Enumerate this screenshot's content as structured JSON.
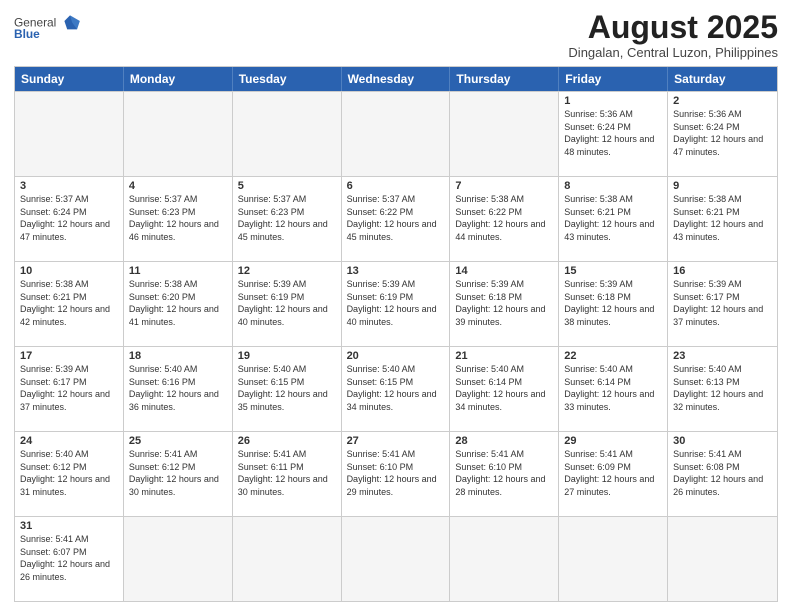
{
  "header": {
    "logo_general": "General",
    "logo_blue": "Blue",
    "month_year": "August 2025",
    "location": "Dingalan, Central Luzon, Philippines"
  },
  "weekdays": [
    "Sunday",
    "Monday",
    "Tuesday",
    "Wednesday",
    "Thursday",
    "Friday",
    "Saturday"
  ],
  "weeks": [
    [
      {
        "day": "",
        "info": ""
      },
      {
        "day": "",
        "info": ""
      },
      {
        "day": "",
        "info": ""
      },
      {
        "day": "",
        "info": ""
      },
      {
        "day": "",
        "info": ""
      },
      {
        "day": "1",
        "info": "Sunrise: 5:36 AM\nSunset: 6:24 PM\nDaylight: 12 hours and 48 minutes."
      },
      {
        "day": "2",
        "info": "Sunrise: 5:36 AM\nSunset: 6:24 PM\nDaylight: 12 hours and 47 minutes."
      }
    ],
    [
      {
        "day": "3",
        "info": "Sunrise: 5:37 AM\nSunset: 6:24 PM\nDaylight: 12 hours and 47 minutes."
      },
      {
        "day": "4",
        "info": "Sunrise: 5:37 AM\nSunset: 6:23 PM\nDaylight: 12 hours and 46 minutes."
      },
      {
        "day": "5",
        "info": "Sunrise: 5:37 AM\nSunset: 6:23 PM\nDaylight: 12 hours and 45 minutes."
      },
      {
        "day": "6",
        "info": "Sunrise: 5:37 AM\nSunset: 6:22 PM\nDaylight: 12 hours and 45 minutes."
      },
      {
        "day": "7",
        "info": "Sunrise: 5:38 AM\nSunset: 6:22 PM\nDaylight: 12 hours and 44 minutes."
      },
      {
        "day": "8",
        "info": "Sunrise: 5:38 AM\nSunset: 6:21 PM\nDaylight: 12 hours and 43 minutes."
      },
      {
        "day": "9",
        "info": "Sunrise: 5:38 AM\nSunset: 6:21 PM\nDaylight: 12 hours and 43 minutes."
      }
    ],
    [
      {
        "day": "10",
        "info": "Sunrise: 5:38 AM\nSunset: 6:21 PM\nDaylight: 12 hours and 42 minutes."
      },
      {
        "day": "11",
        "info": "Sunrise: 5:38 AM\nSunset: 6:20 PM\nDaylight: 12 hours and 41 minutes."
      },
      {
        "day": "12",
        "info": "Sunrise: 5:39 AM\nSunset: 6:19 PM\nDaylight: 12 hours and 40 minutes."
      },
      {
        "day": "13",
        "info": "Sunrise: 5:39 AM\nSunset: 6:19 PM\nDaylight: 12 hours and 40 minutes."
      },
      {
        "day": "14",
        "info": "Sunrise: 5:39 AM\nSunset: 6:18 PM\nDaylight: 12 hours and 39 minutes."
      },
      {
        "day": "15",
        "info": "Sunrise: 5:39 AM\nSunset: 6:18 PM\nDaylight: 12 hours and 38 minutes."
      },
      {
        "day": "16",
        "info": "Sunrise: 5:39 AM\nSunset: 6:17 PM\nDaylight: 12 hours and 37 minutes."
      }
    ],
    [
      {
        "day": "17",
        "info": "Sunrise: 5:39 AM\nSunset: 6:17 PM\nDaylight: 12 hours and 37 minutes."
      },
      {
        "day": "18",
        "info": "Sunrise: 5:40 AM\nSunset: 6:16 PM\nDaylight: 12 hours and 36 minutes."
      },
      {
        "day": "19",
        "info": "Sunrise: 5:40 AM\nSunset: 6:15 PM\nDaylight: 12 hours and 35 minutes."
      },
      {
        "day": "20",
        "info": "Sunrise: 5:40 AM\nSunset: 6:15 PM\nDaylight: 12 hours and 34 minutes."
      },
      {
        "day": "21",
        "info": "Sunrise: 5:40 AM\nSunset: 6:14 PM\nDaylight: 12 hours and 34 minutes."
      },
      {
        "day": "22",
        "info": "Sunrise: 5:40 AM\nSunset: 6:14 PM\nDaylight: 12 hours and 33 minutes."
      },
      {
        "day": "23",
        "info": "Sunrise: 5:40 AM\nSunset: 6:13 PM\nDaylight: 12 hours and 32 minutes."
      }
    ],
    [
      {
        "day": "24",
        "info": "Sunrise: 5:40 AM\nSunset: 6:12 PM\nDaylight: 12 hours and 31 minutes."
      },
      {
        "day": "25",
        "info": "Sunrise: 5:41 AM\nSunset: 6:12 PM\nDaylight: 12 hours and 30 minutes."
      },
      {
        "day": "26",
        "info": "Sunrise: 5:41 AM\nSunset: 6:11 PM\nDaylight: 12 hours and 30 minutes."
      },
      {
        "day": "27",
        "info": "Sunrise: 5:41 AM\nSunset: 6:10 PM\nDaylight: 12 hours and 29 minutes."
      },
      {
        "day": "28",
        "info": "Sunrise: 5:41 AM\nSunset: 6:10 PM\nDaylight: 12 hours and 28 minutes."
      },
      {
        "day": "29",
        "info": "Sunrise: 5:41 AM\nSunset: 6:09 PM\nDaylight: 12 hours and 27 minutes."
      },
      {
        "day": "30",
        "info": "Sunrise: 5:41 AM\nSunset: 6:08 PM\nDaylight: 12 hours and 26 minutes."
      }
    ],
    [
      {
        "day": "31",
        "info": "Sunrise: 5:41 AM\nSunset: 6:07 PM\nDaylight: 12 hours and 26 minutes."
      },
      {
        "day": "",
        "info": ""
      },
      {
        "day": "",
        "info": ""
      },
      {
        "day": "",
        "info": ""
      },
      {
        "day": "",
        "info": ""
      },
      {
        "day": "",
        "info": ""
      },
      {
        "day": "",
        "info": ""
      }
    ]
  ]
}
